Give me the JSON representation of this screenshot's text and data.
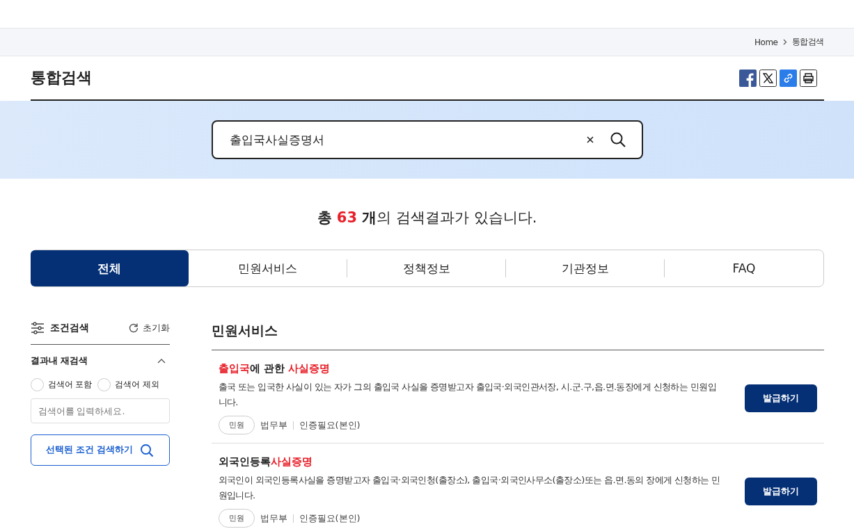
{
  "breadcrumb": [
    "Home",
    "통합검색"
  ],
  "page_title": "통합검색",
  "search": {
    "value": "출입국사실증명서"
  },
  "result_summary": {
    "prefix": "총",
    "count": "63",
    "unit": "개",
    "suffix": "의 검색결과가 있습니다."
  },
  "tabs": [
    {
      "label": "전체",
      "selected": true
    },
    {
      "label": "민원서비스",
      "selected": false
    },
    {
      "label": "정책정보",
      "selected": false
    },
    {
      "label": "기관정보",
      "selected": false
    },
    {
      "label": "FAQ",
      "selected": false
    }
  ],
  "sidebar": {
    "title": "조건검색",
    "reset": "초기화",
    "section": "결과내 재검색",
    "expanded": true,
    "options": [
      {
        "label": "검색어 포함",
        "selected": false
      },
      {
        "label": "검색어 제외",
        "selected": false
      }
    ],
    "placeholder": "검색어를 입력하세요.",
    "submit": "선택된 조건 검색하기"
  },
  "section_title": "민원서비스",
  "results": [
    {
      "title": [
        {
          "text": "출입국",
          "highlight": true
        },
        {
          "text": "에 관한 ",
          "highlight": false
        },
        {
          "text": "사실증명",
          "highlight": true
        }
      ],
      "description": "출국 또는 입국한 사실이 있는 자가 그의 출입국 사실을 증명받고자 출입국·외국인관서장, 시.군.구,읍.면.동장에게 신청하는 민원입니다.",
      "tag": "민원",
      "agency": "법무부",
      "auth": "인증필요(본인)",
      "button": "발급하기"
    },
    {
      "title": [
        {
          "text": "외국인등록",
          "highlight": false
        },
        {
          "text": "사실증명",
          "highlight": true
        }
      ],
      "description": "외국인이 외국인등록사실을 증명받고자 출입국·외국인청(출장소), 출입국·외국인사무소(출장소)또는 읍.면.동의 장에게 신청하는 민원입니다.",
      "tag": "민원",
      "agency": "법무부",
      "auth": "인증필요(본인)",
      "button": "발급하기"
    }
  ]
}
